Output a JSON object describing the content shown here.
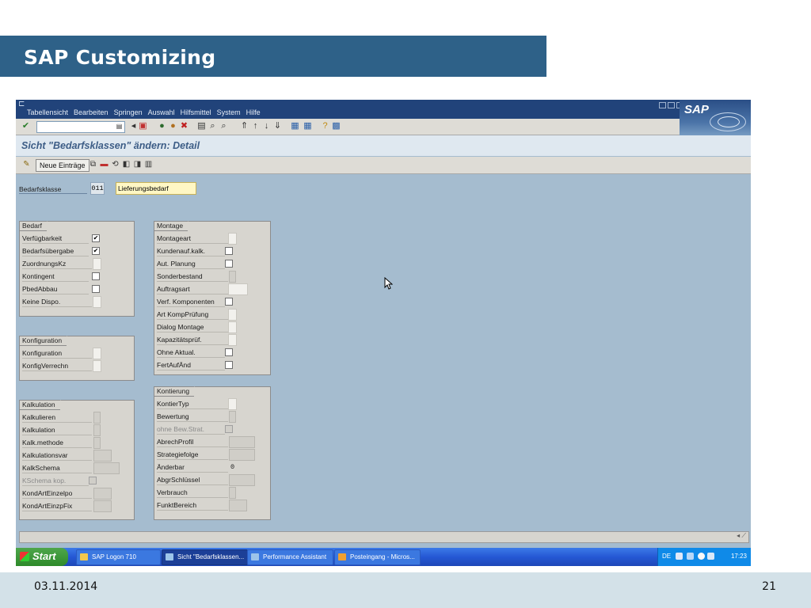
{
  "slide": {
    "title": "SAP Customizing",
    "date": "03.11.2014",
    "page": "21"
  },
  "menu": {
    "items": [
      "Tabellensicht",
      "Bearbeiten",
      "Springen",
      "Auswahl",
      "Hilfsmittel",
      "System",
      "Hilfe"
    ]
  },
  "screen_title": "Sicht \"Bedarfsklassen\" ändern: Detail",
  "app_toolbar": {
    "new_entries": "Neue Einträge"
  },
  "header": {
    "label": "Bedarfsklasse",
    "value": "011",
    "text": "Lieferungsbedarf"
  },
  "groups": {
    "bedarf": {
      "title": "Bedarf",
      "rows": [
        {
          "label": "Verfügbarkeit",
          "type": "checkbox",
          "checked": true
        },
        {
          "label": "Bedarfsübergabe",
          "type": "checkbox",
          "checked": true
        },
        {
          "label": "ZuordnungsKz",
          "type": "input"
        },
        {
          "label": "Kontingent",
          "type": "checkbox",
          "checked": false
        },
        {
          "label": "PbedAbbau",
          "type": "checkbox",
          "checked": false
        },
        {
          "label": "Keine Dispo.",
          "type": "input"
        }
      ]
    },
    "konfiguration": {
      "title": "Konfiguration",
      "rows": [
        {
          "label": "Konfiguration",
          "type": "input"
        },
        {
          "label": "KonfigVerrechn",
          "type": "input"
        }
      ]
    },
    "kalkulation": {
      "title": "Kalkulation",
      "rows": [
        {
          "label": "Kalkulieren",
          "type": "input"
        },
        {
          "label": "Kalkulation",
          "type": "input"
        },
        {
          "label": "Kalk.methode",
          "type": "input"
        },
        {
          "label": "Kalkulationsvar",
          "type": "input"
        },
        {
          "label": "KalkSchema",
          "type": "input"
        },
        {
          "label": "KSchema kop.",
          "type": "checkbox",
          "checked": false,
          "disabled": true
        },
        {
          "label": "KondArtEinzelpo",
          "type": "input"
        },
        {
          "label": "KondArtEinzpFix",
          "type": "input"
        }
      ]
    },
    "montage": {
      "title": "Montage",
      "rows": [
        {
          "label": "Montageart",
          "type": "input"
        },
        {
          "label": "Kundenauf.kalk.",
          "type": "checkbox",
          "checked": false
        },
        {
          "label": "Aut. Planung",
          "type": "checkbox",
          "checked": false
        },
        {
          "label": "Sonderbestand",
          "type": "input"
        },
        {
          "label": "Auftragsart",
          "type": "input"
        },
        {
          "label": "Verf. Komponenten",
          "type": "checkbox",
          "checked": false
        },
        {
          "label": "Art KompPrüfung",
          "type": "input"
        },
        {
          "label": "Dialog Montage",
          "type": "input"
        },
        {
          "label": "Kapazitätsprüf.",
          "type": "input"
        },
        {
          "label": "Ohne Aktual.",
          "type": "checkbox",
          "checked": false
        },
        {
          "label": "FertAufÄnd",
          "type": "checkbox",
          "checked": false
        }
      ]
    },
    "kontierung": {
      "title": "Kontierung",
      "rows": [
        {
          "label": "KontierTyp",
          "type": "input"
        },
        {
          "label": "Bewertung",
          "type": "input"
        },
        {
          "label": "ohne Bew.Strat.",
          "type": "checkbox",
          "checked": false,
          "disabled": true
        },
        {
          "label": "AbrechProfil",
          "type": "input"
        },
        {
          "label": "Strategiefolge",
          "type": "input"
        },
        {
          "label": "Änderbar",
          "type": "value",
          "value": "0"
        },
        {
          "label": "AbgrSchlüssel",
          "type": "input"
        },
        {
          "label": "Verbrauch",
          "type": "input"
        },
        {
          "label": "FunktBereich",
          "type": "input"
        }
      ]
    }
  },
  "taskbar": {
    "start": "Start",
    "buttons": [
      "SAP Logon 710",
      "Sicht \"Bedarfsklassen...",
      "Performance Assistant",
      "Posteingang - Micros..."
    ],
    "lang": "DE",
    "clock": "17:23"
  },
  "colors": {
    "title_bar": "#2e6188",
    "footer": "#d3e1e8",
    "sap_bg": "#a5bccf",
    "menubar": "#21437a"
  }
}
